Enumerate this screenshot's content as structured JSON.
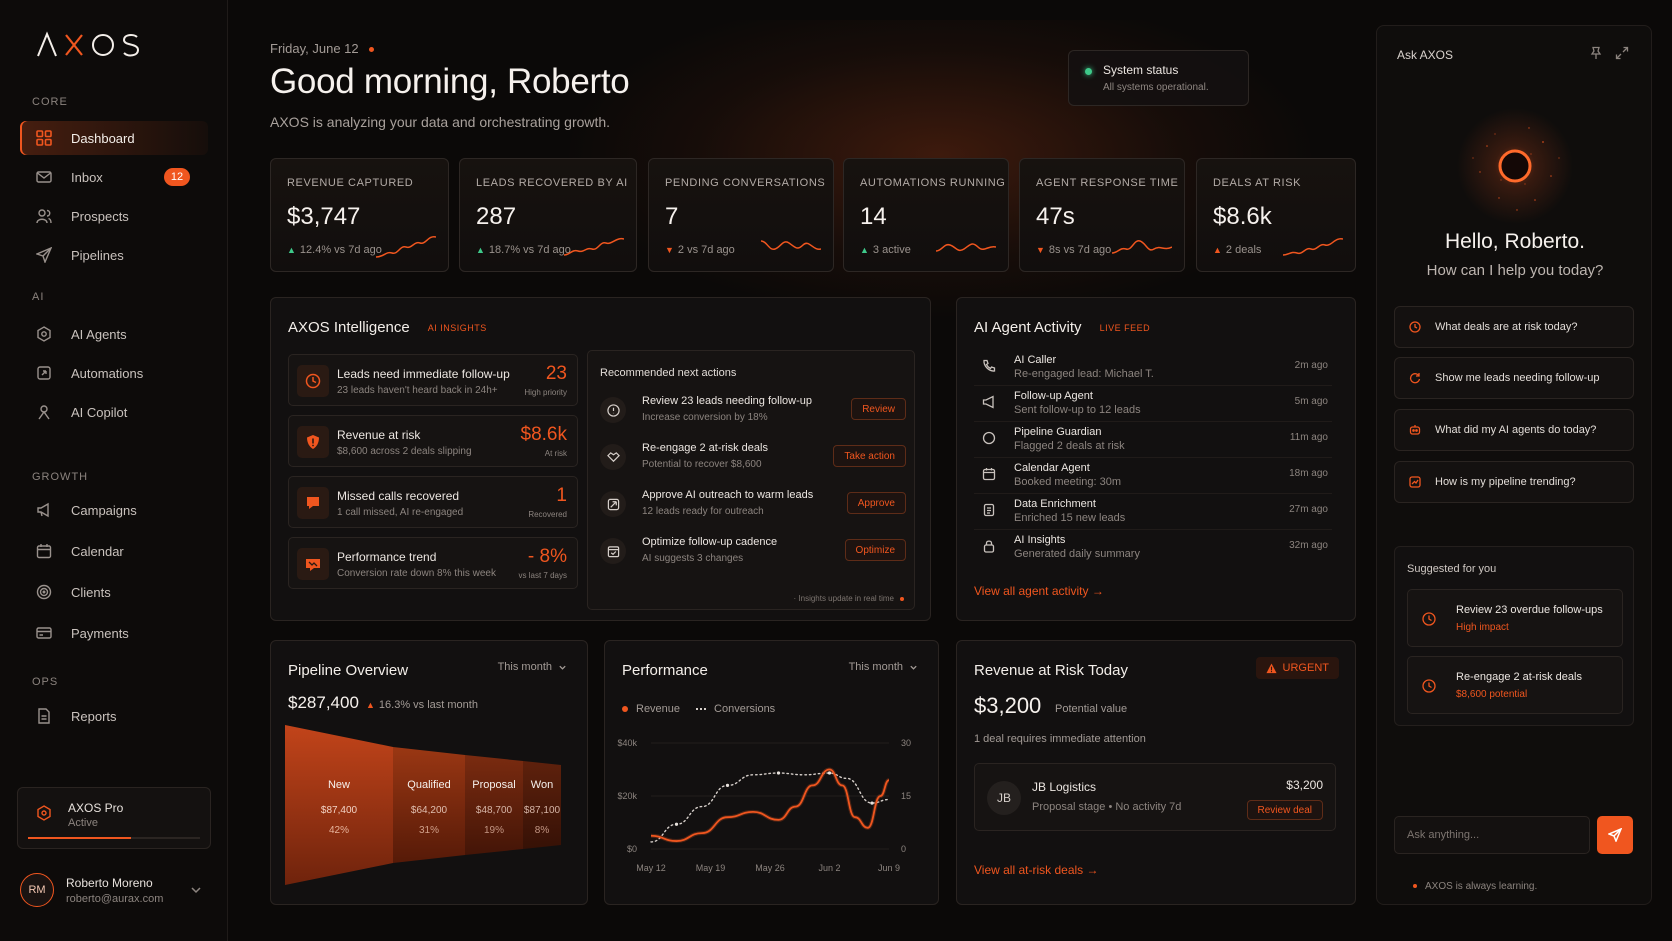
{
  "brand": {
    "name": "AXOS"
  },
  "sidebar": {
    "sections": {
      "core": "CORE",
      "ai": "AI",
      "growth": "GROWTH",
      "ops": "OPS"
    },
    "items": {
      "dashboard": "Dashboard",
      "inbox": "Inbox",
      "inbox_badge": "12",
      "prospects": "Prospects",
      "pipelines": "Pipelines",
      "ai_agents": "AI Agents",
      "automations": "Automations",
      "ai_copilot": "AI Copilot",
      "campaigns": "Campaigns",
      "calendar": "Calendar",
      "clients": "Clients",
      "payments": "Payments",
      "reports": "Reports"
    },
    "plan": {
      "title": "AXOS Pro",
      "status": "Active",
      "progress": 0.6
    },
    "user": {
      "initials": "RM",
      "name": "Roberto Moreno",
      "email": "roberto@aurax.com"
    }
  },
  "header": {
    "date": "Friday, June 12",
    "greeting": "Good morning, Roberto",
    "subtitle": "AXOS is analyzing your data and orchestrating growth.",
    "status": {
      "title": "System status",
      "sub": "All systems operational."
    }
  },
  "kpis": [
    {
      "label": "REVENUE CAPTURED",
      "value": "$3,747",
      "delta": "12.4% vs 7d ago",
      "dir": "up"
    },
    {
      "label": "LEADS RECOVERED BY AI",
      "value": "287",
      "delta": "18.7% vs 7d ago",
      "dir": "up"
    },
    {
      "label": "PENDING CONVERSATIONS",
      "value": "7",
      "delta": "2 vs 7d ago",
      "dir": "down"
    },
    {
      "label": "AUTOMATIONS RUNNING",
      "value": "14",
      "delta": "3 active",
      "dir": "up"
    },
    {
      "label": "AGENT RESPONSE TIME",
      "value": "47s",
      "delta": "8s vs 7d ago",
      "dir": "down"
    },
    {
      "label": "DEALS AT RISK",
      "value": "$8.6k",
      "delta": "2 deals",
      "dir": "upo"
    }
  ],
  "intelligence": {
    "title": "AXOS Intelligence",
    "tag": "AI INSIGHTS",
    "insights": [
      {
        "title": "Leads need immediate follow-up",
        "sub": "23 leads haven't heard back in 24h+",
        "num": "23",
        "numsub": "High priority"
      },
      {
        "title": "Revenue at risk",
        "sub": "$8,600 across 2 deals slipping",
        "num": "$8.6k",
        "numsub": "At risk"
      },
      {
        "title": "Missed calls recovered",
        "sub": "1 call missed, AI re-engaged",
        "num": "1",
        "numsub": "Recovered"
      },
      {
        "title": "Performance trend",
        "sub": "Conversion rate down 8% this week",
        "num": "- 8%",
        "numsub": "vs last 7 days"
      }
    ],
    "recommended": {
      "title": "Recommended next actions",
      "items": [
        {
          "title": "Review 23 leads needing follow-up",
          "sub": "Increase conversion by 18%",
          "action": "Review"
        },
        {
          "title": "Re-engage 2 at-risk deals",
          "sub": "Potential to recover $8,600",
          "action": "Take action"
        },
        {
          "title": "Approve AI outreach to warm leads",
          "sub": "12 leads ready for outreach",
          "action": "Approve"
        },
        {
          "title": "Optimize follow-up cadence",
          "sub": "AI suggests 3 changes",
          "action": "Optimize"
        }
      ],
      "footer": "Insights update in real time"
    }
  },
  "activity": {
    "title": "AI Agent Activity",
    "tag": "LIVE FEED",
    "items": [
      {
        "title": "AI Caller",
        "sub": "Re-engaged lead: Michael T.",
        "time": "2m ago"
      },
      {
        "title": "Follow-up Agent",
        "sub": "Sent follow-up to 12 leads",
        "time": "5m ago"
      },
      {
        "title": "Pipeline Guardian",
        "sub": "Flagged 2 deals at risk",
        "time": "11m ago"
      },
      {
        "title": "Calendar Agent",
        "sub": "Booked meeting: 30m",
        "time": "18m ago"
      },
      {
        "title": "Data Enrichment",
        "sub": "Enriched 15 new leads",
        "time": "27m ago"
      },
      {
        "title": "AI Insights",
        "sub": "Generated daily summary",
        "time": "32m ago"
      }
    ],
    "link": "View all agent activity"
  },
  "pipeline": {
    "title": "Pipeline Overview",
    "range": "This month",
    "total": "$287,400",
    "delta": "16.3% vs last month",
    "stages": [
      {
        "name": "New",
        "value": "$87,400",
        "pct": "42%"
      },
      {
        "name": "Qualified",
        "value": "$64,200",
        "pct": "31%"
      },
      {
        "name": "Proposal",
        "value": "$48,700",
        "pct": "19%"
      },
      {
        "name": "Won",
        "value": "$87,100",
        "pct": "8%"
      }
    ]
  },
  "performance": {
    "title": "Performance",
    "range": "This month",
    "legend": {
      "revenue": "Revenue",
      "conversions": "Conversions"
    }
  },
  "chart_data": {
    "type": "line",
    "x": [
      "May 12",
      "May 19",
      "May 26",
      "Jun 2",
      "Jun 9"
    ],
    "x_positions_days": [
      0,
      7,
      14,
      21,
      28
    ],
    "y_left_ticks": [
      "$0",
      "$20k",
      "$40k"
    ],
    "y_right_ticks": [
      "0",
      "15",
      "30"
    ],
    "ylim_left": [
      0,
      40000
    ],
    "ylim_right": [
      0,
      30
    ],
    "series": [
      {
        "name": "Revenue",
        "axis": "left",
        "points": [
          [
            0,
            5000
          ],
          [
            3,
            3000
          ],
          [
            6,
            6000
          ],
          [
            9,
            12000
          ],
          [
            12,
            14000
          ],
          [
            15,
            11000
          ],
          [
            17,
            16000
          ],
          [
            19,
            24000
          ],
          [
            21,
            30000
          ],
          [
            22.5,
            24000
          ],
          [
            24,
            12000
          ],
          [
            25.5,
            8000
          ],
          [
            27,
            20000
          ],
          [
            28,
            26000
          ]
        ]
      },
      {
        "name": "Conversions",
        "axis": "right",
        "points": [
          [
            0,
            2
          ],
          [
            3,
            7
          ],
          [
            6,
            12
          ],
          [
            9,
            18
          ],
          [
            12,
            21
          ],
          [
            15,
            21.5
          ],
          [
            18,
            21
          ],
          [
            21,
            21.5
          ],
          [
            23,
            20
          ],
          [
            26,
            13
          ],
          [
            28,
            14
          ]
        ]
      }
    ]
  },
  "risk": {
    "title": "Revenue at Risk Today",
    "badge": "URGENT",
    "value": "$3,200",
    "value_sub": "Potential value",
    "note": "1 deal requires immediate attention",
    "deal": {
      "initials": "JB",
      "name": "JB Logistics",
      "stage": "Proposal stage",
      "activity": "No activity 7d",
      "amount": "$3,200",
      "action": "Review deal"
    },
    "link": "View all at-risk deals"
  },
  "ask": {
    "title": "Ask AXOS",
    "hello": "Hello, Roberto.",
    "help": "How can I help you today?",
    "prompts": [
      "What deals are at risk today?",
      "Show me leads needing follow-up",
      "What did my AI agents do today?",
      "How is my pipeline trending?"
    ],
    "suggested": {
      "title": "Suggested for you",
      "items": [
        {
          "title": "Review 23 overdue follow-ups",
          "sub": "High impact"
        },
        {
          "title": "Re-engage 2 at-risk deals",
          "sub": "$8,600 potential"
        }
      ]
    },
    "input_placeholder": "Ask anything...",
    "footer": "AXOS is always learning."
  }
}
